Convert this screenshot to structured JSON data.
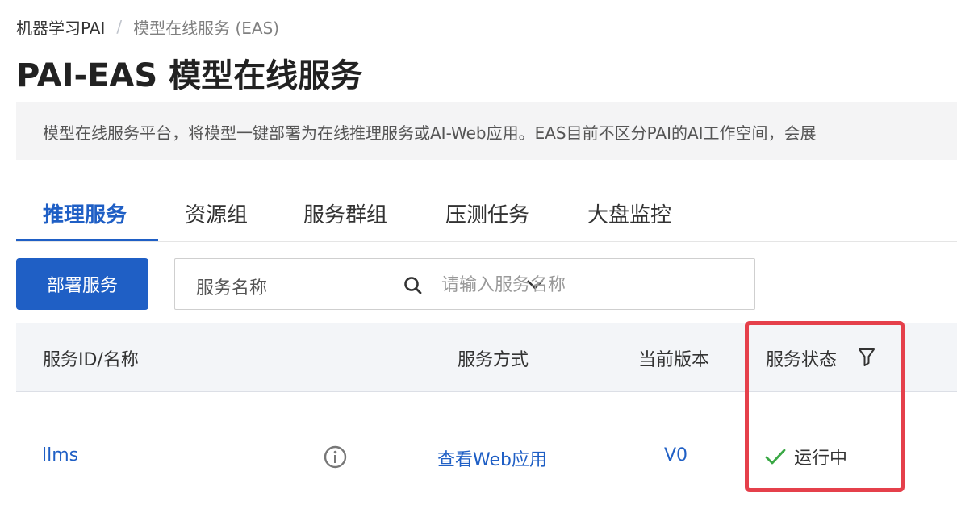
{
  "breadcrumb": {
    "home": "机器学习PAI",
    "separator": "/",
    "current": "模型在线服务 (EAS)"
  },
  "page": {
    "title": "PAI-EAS 模型在线服务",
    "description": "模型在线服务平台，将模型一键部署为在线推理服务或AI-Web应用。EAS目前不区分PAI的AI工作空间，会展"
  },
  "tabs": [
    {
      "label": "推理服务",
      "active": true
    },
    {
      "label": "资源组",
      "active": false
    },
    {
      "label": "服务群组",
      "active": false
    },
    {
      "label": "压测任务",
      "active": false
    },
    {
      "label": "大盘监控",
      "active": false
    }
  ],
  "toolbar": {
    "deploy_label": "部署服务",
    "search_field_selected": "服务名称",
    "search_placeholder": "请输入服务名称"
  },
  "table": {
    "columns": {
      "id_name": "服务ID/名称",
      "method": "服务方式",
      "version": "当前版本",
      "status": "服务状态"
    },
    "rows": [
      {
        "name": "llms",
        "method": "查看Web应用",
        "version": "V0",
        "status": "运行中"
      }
    ]
  },
  "colors": {
    "primary": "#1f5fc5",
    "success": "#3aa845",
    "highlight": "#e5404b"
  },
  "icons": {
    "dropdown": "chevron-down-icon",
    "search": "search-icon",
    "filter": "filter-icon",
    "info": "info-icon",
    "status": "check-icon"
  }
}
